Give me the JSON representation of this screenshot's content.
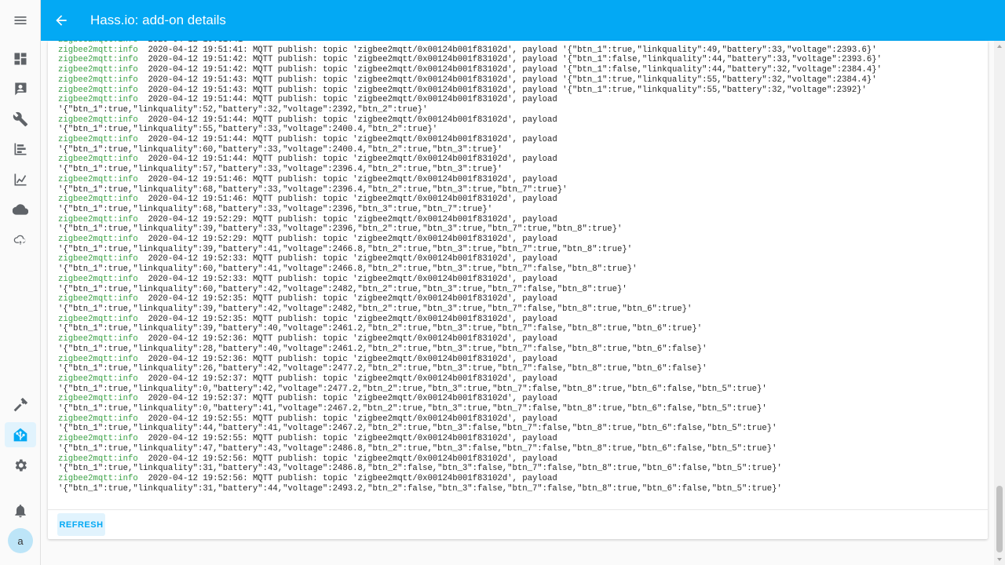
{
  "header": {
    "title": "Hass.io: add-on details",
    "accent_color": "#03a9f4"
  },
  "sidebar": {
    "top_icons": [
      "menu-icon",
      "overview-icon",
      "logbook-icon",
      "configuration-wrench-icon",
      "history-icon",
      "chart-icon",
      "cloud-icon",
      "cloud-sync-icon"
    ],
    "bottom_icons": [
      "developer-tools-hammer-icon",
      "hassio-icon",
      "settings-gear-icon",
      "notifications-bell-icon"
    ],
    "avatar_initial": "a"
  },
  "log": {
    "level_label": "zigbee2mqtt:info",
    "entries": [
      {
        "ts": "2020-04-12 19:51:41",
        "msg": "MQTT publish: topic 'zigbee2mqtt/0x00124b001f83102d', payload '{\"btn_1\":true,\"linkquality\":49,\"battery\":33,\"voltage\":2393.6}'",
        "cont": ""
      },
      {
        "ts": "2020-04-12 19:51:42",
        "msg": "MQTT publish: topic 'zigbee2mqtt/0x00124b001f83102d', payload '{\"btn_1\":false,\"linkquality\":44,\"battery\":33,\"voltage\":2393.6}'",
        "cont": ""
      },
      {
        "ts": "2020-04-12 19:51:42",
        "msg": "MQTT publish: topic 'zigbee2mqtt/0x00124b001f83102d', payload '{\"btn_1\":false,\"linkquality\":44,\"battery\":32,\"voltage\":2384.4}'",
        "cont": ""
      },
      {
        "ts": "2020-04-12 19:51:43",
        "msg": "MQTT publish: topic 'zigbee2mqtt/0x00124b001f83102d', payload '{\"btn_1\":true,\"linkquality\":55,\"battery\":32,\"voltage\":2384.4}'",
        "cont": ""
      },
      {
        "ts": "2020-04-12 19:51:43",
        "msg": "MQTT publish: topic 'zigbee2mqtt/0x00124b001f83102d', payload '{\"btn_1\":true,\"linkquality\":55,\"battery\":32,\"voltage\":2392}'",
        "cont": ""
      },
      {
        "ts": "2020-04-12 19:51:44",
        "msg": "MQTT publish: topic 'zigbee2mqtt/0x00124b001f83102d', payload",
        "cont": "'{\"btn_1\":true,\"linkquality\":52,\"battery\":32,\"voltage\":2392,\"btn_2\":true}'"
      },
      {
        "ts": "2020-04-12 19:51:44",
        "msg": "MQTT publish: topic 'zigbee2mqtt/0x00124b001f83102d', payload",
        "cont": "'{\"btn_1\":true,\"linkquality\":55,\"battery\":33,\"voltage\":2400.4,\"btn_2\":true}'"
      },
      {
        "ts": "2020-04-12 19:51:44",
        "msg": "MQTT publish: topic 'zigbee2mqtt/0x00124b001f83102d', payload",
        "cont": "'{\"btn_1\":true,\"linkquality\":60,\"battery\":33,\"voltage\":2400.4,\"btn_2\":true,\"btn_3\":true}'"
      },
      {
        "ts": "2020-04-12 19:51:44",
        "msg": "MQTT publish: topic 'zigbee2mqtt/0x00124b001f83102d', payload",
        "cont": "'{\"btn_1\":true,\"linkquality\":57,\"battery\":33,\"voltage\":2396.4,\"btn_2\":true,\"btn_3\":true}'"
      },
      {
        "ts": "2020-04-12 19:51:46",
        "msg": "MQTT publish: topic 'zigbee2mqtt/0x00124b001f83102d', payload",
        "cont": "'{\"btn_1\":true,\"linkquality\":68,\"battery\":33,\"voltage\":2396.4,\"btn_2\":true,\"btn_3\":true,\"btn_7\":true}'"
      },
      {
        "ts": "2020-04-12 19:51:46",
        "msg": "MQTT publish: topic 'zigbee2mqtt/0x00124b001f83102d', payload",
        "cont": "'{\"btn_1\":true,\"linkquality\":68,\"battery\":33,\"voltage\":2396,\"btn_3\":true,\"btn_7\":true}'"
      },
      {
        "ts": "2020-04-12 19:52:29",
        "msg": "MQTT publish: topic 'zigbee2mqtt/0x00124b001f83102d', payload",
        "cont": "'{\"btn_1\":true,\"linkquality\":39,\"battery\":33,\"voltage\":2396,\"btn_2\":true,\"btn_3\":true,\"btn_7\":true,\"btn_8\":true}'"
      },
      {
        "ts": "2020-04-12 19:52:29",
        "msg": "MQTT publish: topic 'zigbee2mqtt/0x00124b001f83102d', payload",
        "cont": "'{\"btn_1\":true,\"linkquality\":39,\"battery\":41,\"voltage\":2466.8,\"btn_2\":true,\"btn_3\":true,\"btn_7\":true,\"btn_8\":true}'"
      },
      {
        "ts": "2020-04-12 19:52:33",
        "msg": "MQTT publish: topic 'zigbee2mqtt/0x00124b001f83102d', payload",
        "cont": "'{\"btn_1\":true,\"linkquality\":60,\"battery\":41,\"voltage\":2466.8,\"btn_2\":true,\"btn_3\":true,\"btn_7\":false,\"btn_8\":true}'"
      },
      {
        "ts": "2020-04-12 19:52:33",
        "msg": "MQTT publish: topic 'zigbee2mqtt/0x00124b001f83102d', payload",
        "cont": "'{\"btn_1\":true,\"linkquality\":60,\"battery\":42,\"voltage\":2482,\"btn_2\":true,\"btn_3\":true,\"btn_7\":false,\"btn_8\":true}'"
      },
      {
        "ts": "2020-04-12 19:52:35",
        "msg": "MQTT publish: topic 'zigbee2mqtt/0x00124b001f83102d', payload",
        "cont": "'{\"btn_1\":true,\"linkquality\":39,\"battery\":42,\"voltage\":2482,\"btn_2\":true,\"btn_3\":true,\"btn_7\":false,\"btn_8\":true,\"btn_6\":true}'"
      },
      {
        "ts": "2020-04-12 19:52:35",
        "msg": "MQTT publish: topic 'zigbee2mqtt/0x00124b001f83102d', payload",
        "cont": "'{\"btn_1\":true,\"linkquality\":39,\"battery\":40,\"voltage\":2461.2,\"btn_2\":true,\"btn_3\":true,\"btn_7\":false,\"btn_8\":true,\"btn_6\":true}'"
      },
      {
        "ts": "2020-04-12 19:52:36",
        "msg": "MQTT publish: topic 'zigbee2mqtt/0x00124b001f83102d', payload",
        "cont": "'{\"btn_1\":true,\"linkquality\":28,\"battery\":40,\"voltage\":2461.2,\"btn_2\":true,\"btn_3\":true,\"btn_7\":false,\"btn_8\":true,\"btn_6\":false}'"
      },
      {
        "ts": "2020-04-12 19:52:36",
        "msg": "MQTT publish: topic 'zigbee2mqtt/0x00124b001f83102d', payload",
        "cont": "'{\"btn_1\":true,\"linkquality\":26,\"battery\":42,\"voltage\":2477.2,\"btn_2\":true,\"btn_3\":true,\"btn_7\":false,\"btn_8\":true,\"btn_6\":false}'"
      },
      {
        "ts": "2020-04-12 19:52:37",
        "msg": "MQTT publish: topic 'zigbee2mqtt/0x00124b001f83102d', payload",
        "cont": "'{\"btn_1\":true,\"linkquality\":0,\"battery\":42,\"voltage\":2477.2,\"btn_2\":true,\"btn_3\":true,\"btn_7\":false,\"btn_8\":true,\"btn_6\":false,\"btn_5\":true}'"
      },
      {
        "ts": "2020-04-12 19:52:37",
        "msg": "MQTT publish: topic 'zigbee2mqtt/0x00124b001f83102d', payload",
        "cont": "'{\"btn_1\":true,\"linkquality\":0,\"battery\":41,\"voltage\":2467.2,\"btn_2\":true,\"btn_3\":true,\"btn_7\":false,\"btn_8\":true,\"btn_6\":false,\"btn_5\":true}'"
      },
      {
        "ts": "2020-04-12 19:52:55",
        "msg": "MQTT publish: topic 'zigbee2mqtt/0x00124b001f83102d', payload",
        "cont": "'{\"btn_1\":true,\"linkquality\":44,\"battery\":41,\"voltage\":2467.2,\"btn_2\":true,\"btn_3\":false,\"btn_7\":false,\"btn_8\":true,\"btn_6\":false,\"btn_5\":true}'"
      },
      {
        "ts": "2020-04-12 19:52:55",
        "msg": "MQTT publish: topic 'zigbee2mqtt/0x00124b001f83102d', payload",
        "cont": "'{\"btn_1\":true,\"linkquality\":47,\"battery\":43,\"voltage\":2486.8,\"btn_2\":true,\"btn_3\":false,\"btn_7\":false,\"btn_8\":true,\"btn_6\":false,\"btn_5\":true}'"
      },
      {
        "ts": "2020-04-12 19:52:56",
        "msg": "MQTT publish: topic 'zigbee2mqtt/0x00124b001f83102d', payload",
        "cont": "'{\"btn_1\":true,\"linkquality\":31,\"battery\":43,\"voltage\":2486.8,\"btn_2\":false,\"btn_3\":false,\"btn_7\":false,\"btn_8\":true,\"btn_6\":false,\"btn_5\":true}'"
      },
      {
        "ts": "2020-04-12 19:52:56",
        "msg": "MQTT publish: topic 'zigbee2mqtt/0x00124b001f83102d', payload",
        "cont": "'{\"btn_1\":true,\"linkquality\":31,\"battery\":44,\"voltage\":2493.2,\"btn_2\":false,\"btn_3\":false,\"btn_7\":false,\"btn_8\":true,\"btn_6\":false,\"btn_5\":true}'"
      }
    ]
  },
  "actions": {
    "refresh_label": "REFRESH"
  }
}
